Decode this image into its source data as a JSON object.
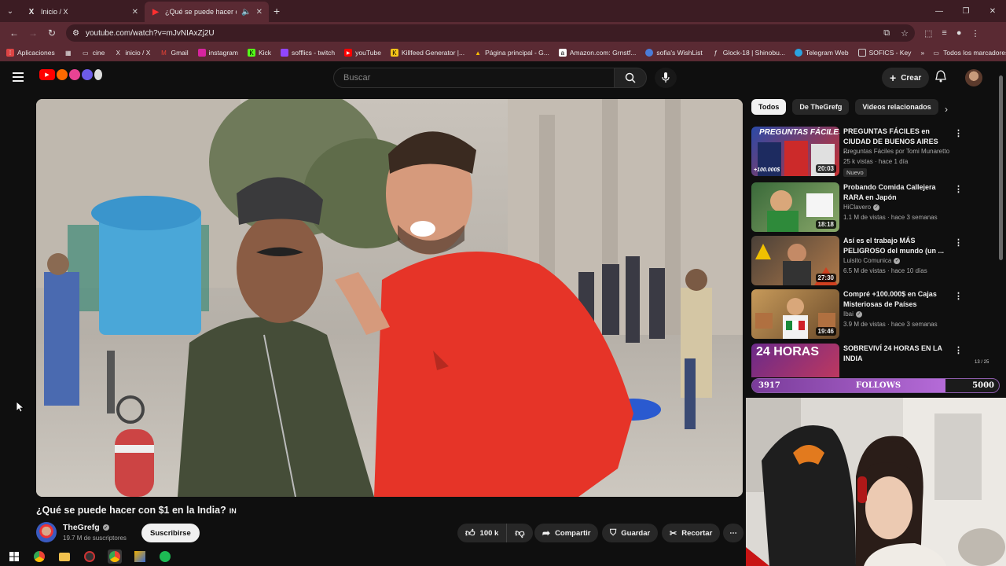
{
  "browser": {
    "tabs": [
      {
        "title": "Inicio / X",
        "icon": "x-logo-icon",
        "active": false
      },
      {
        "title": "¿Qué se puede hacer con $",
        "icon": "youtube-icon",
        "active": true
      }
    ],
    "url": "youtube.com/watch?v=mJvNIAxZj2U",
    "bookmarks": [
      "Aplicaciones",
      "cine",
      "inicio / X",
      "Gmail",
      "instagram",
      "Kick",
      "sofflics - twitch",
      "youTube",
      "Killfeed Generator |...",
      "Página principal - G...",
      "Amazon.com: Grnstf...",
      "sofia's WishList",
      "Glock-18 | Shinobu...",
      "Telegram Web",
      "SOFICS - Key"
    ],
    "all_bookmarks": "Todos los marcadores"
  },
  "header": {
    "search_placeholder": "Buscar",
    "create_label": "Crear"
  },
  "video": {
    "title": "¿Qué se puede hacer con $1 en la India?",
    "title_badge": "IN",
    "channel": "TheGrefg",
    "subscribers": "19.7 M de suscriptores",
    "subscribe_label": "Suscribirse",
    "likes": "100 k",
    "share_label": "Compartir",
    "save_label": "Guardar",
    "clip_label": "Recortar"
  },
  "sidebar": {
    "chips": [
      "Todos",
      "De TheGrefg",
      "Videos relacionados"
    ],
    "items": [
      {
        "title": "PREGUNTAS FÁCILES en CIUDAD DE BUENOS AIRES ...",
        "channel": "Preguntas Fáciles por Tomi Munaretto",
        "meta": "25 k vistas · hace 1 día",
        "badge": "Nuevo",
        "duration": "20:03",
        "verified": false
      },
      {
        "title": "Probando Comida Callejera RARA en Japón",
        "channel": "HiClavero",
        "meta": "1.1 M de vistas · hace 3 semanas",
        "badge": "",
        "duration": "18:18",
        "verified": true
      },
      {
        "title": "Así es el trabajo MÁS PELIGROSO del mundo (un ...",
        "channel": "Luisito Comunica",
        "meta": "6.5 M de vistas · hace 10 días",
        "badge": "",
        "duration": "27:30",
        "verified": true
      },
      {
        "title": "Compré +100.000$ en Cajas Misteriosas de Países",
        "channel": "Ibai",
        "meta": "3.9 M de vistas · hace 3 semanas",
        "badge": "",
        "duration": "19:46",
        "verified": true
      },
      {
        "title": "SOBREVIVÍ 24 HORAS EN LA INDIA",
        "channel": "",
        "meta": "",
        "badge": "",
        "duration": "",
        "verified": false
      }
    ],
    "thumb_texts": [
      "PREGUNTAS FÁCILES",
      "+100.000$",
      "24 HORAS"
    ]
  },
  "overlay": {
    "current": "3917",
    "label": "FOLLOWS",
    "goal": "5000",
    "progress": 0.783,
    "small": "13 / 25"
  },
  "colors": {
    "youtube_red": "#ff0000",
    "browser_frame": "#5a2a33",
    "goal_purple": "#b56bd8"
  }
}
